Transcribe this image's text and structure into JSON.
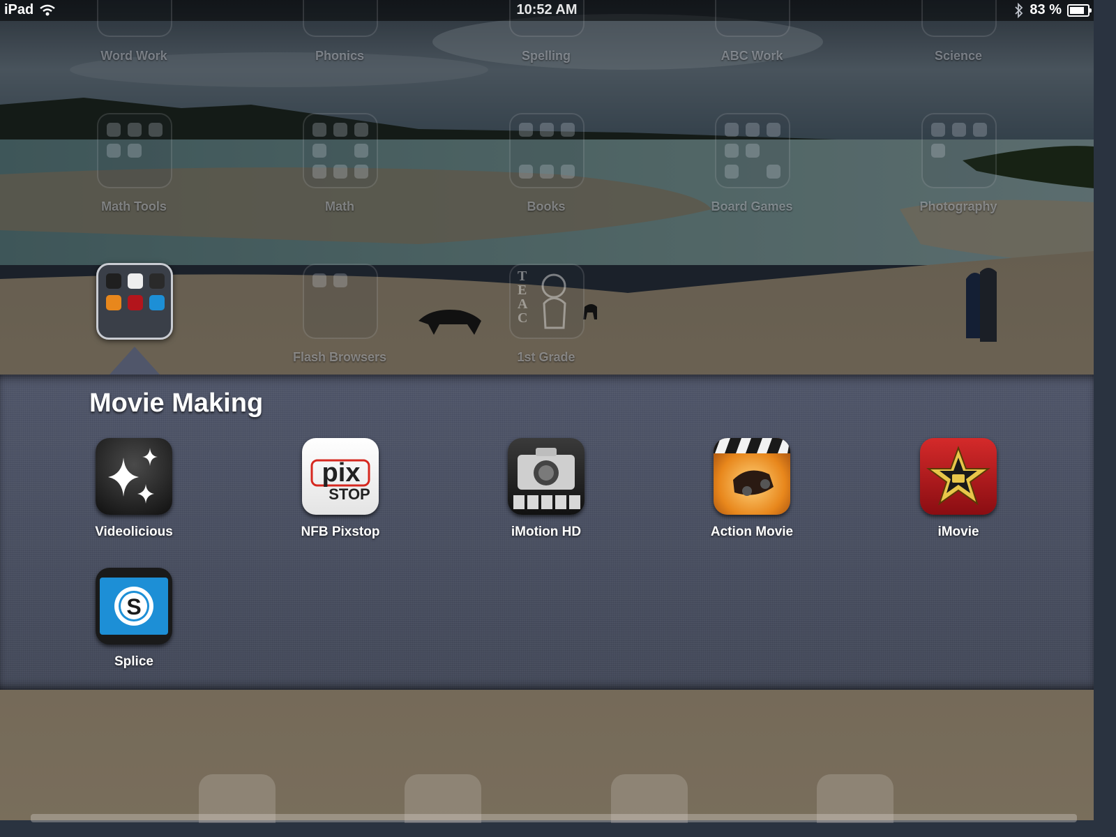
{
  "status_bar": {
    "device": "iPad",
    "time": "10:52 AM",
    "battery_text": "83 %",
    "battery_level": 0.83,
    "wifi_icon": "wifi-icon",
    "bluetooth_icon": "bluetooth-icon"
  },
  "home_folders": [
    {
      "label": "Word Work"
    },
    {
      "label": "Phonics"
    },
    {
      "label": "Spelling"
    },
    {
      "label": "ABC Work"
    },
    {
      "label": "Science"
    },
    {
      "label": "Math Tools"
    },
    {
      "label": "Math"
    },
    {
      "label": "Books"
    },
    {
      "label": "Board Games"
    },
    {
      "label": "Photography"
    },
    {
      "label": "Flash Browsers"
    },
    {
      "label": "1st Grade"
    }
  ],
  "open_folder": {
    "title": "Movie Making",
    "apps": [
      {
        "label": "Videolicious",
        "icon": "sparkles-icon"
      },
      {
        "label": "NFB Pixstop",
        "icon": "pixstop-icon",
        "icon_text_top": "pix",
        "icon_text_bottom": "STOP"
      },
      {
        "label": "iMotion HD",
        "icon": "camera-icon"
      },
      {
        "label": "Action Movie",
        "icon": "clapperboard-car-icon"
      },
      {
        "label": "iMovie",
        "icon": "star-film-icon"
      },
      {
        "label": "Splice",
        "icon": "splice-icon",
        "icon_text": "S"
      }
    ]
  },
  "colors": {
    "panel": "#4a5060",
    "imovie_red": "#b3151c",
    "splice_blue": "#1d8fd6",
    "action_orange": "#e8871c"
  }
}
